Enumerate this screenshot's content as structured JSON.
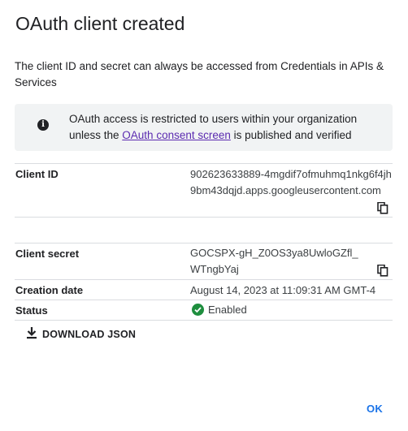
{
  "dialog": {
    "title": "OAuth client created",
    "intro": "The client ID and secret can always be accessed from Credentials in APIs & Services"
  },
  "info_box": {
    "icon": "info-icon",
    "text_before": "OAuth access is restricted to users within your organization unless the ",
    "link_text": "OAuth consent screen",
    "text_after": " is published and verified"
  },
  "fields": {
    "client_id_label": "Client ID",
    "client_id_value": "902623633889-4mgdif7ofmuhmq1nkg6f4jh9bm43dqjd.apps.googleusercontent.com",
    "client_secret_label": "Client secret",
    "client_secret_value": "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",
    "creation_date_label": "Creation date",
    "creation_date_value": "August 14, 2023 at 11:09:31 AM GMT-4",
    "status_label": "Status",
    "status_value": "Enabled"
  },
  "actions": {
    "download_label": "DOWNLOAD JSON",
    "ok_label": "OK"
  },
  "colors": {
    "link": "#5b2bb0",
    "status_green": "#1e8e3e",
    "ok_blue": "#1a73e8"
  }
}
